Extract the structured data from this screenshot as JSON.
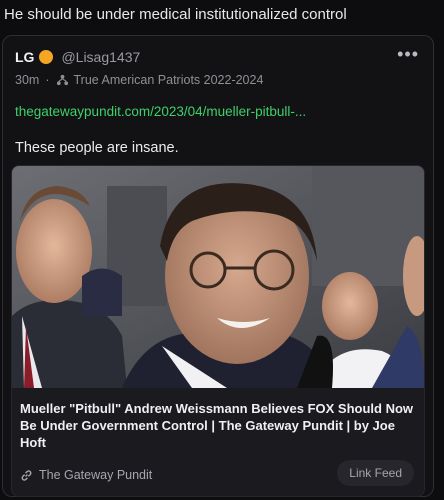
{
  "header": {
    "text": "He should be under medical institutionalized control"
  },
  "post": {
    "author_name": "LG",
    "handle": "@Lisag1437",
    "time": "30m",
    "community": "True American Patriots 2022-2024",
    "more_label": "•••",
    "link_text": "thegatewaypundit.com/2023/04/mueller-pitbull-...",
    "body": "These people are insane."
  },
  "preview": {
    "title": "Mueller \"Pitbull\" Andrew Weissmann Believes FOX Should Now Be Under Government Control | The Gateway Pundit | by Joe Hoft",
    "site": "The Gateway Pundit",
    "button": "Link Feed"
  },
  "colors": {
    "accent_link": "#3fd06b",
    "badge": "#f5a623"
  }
}
